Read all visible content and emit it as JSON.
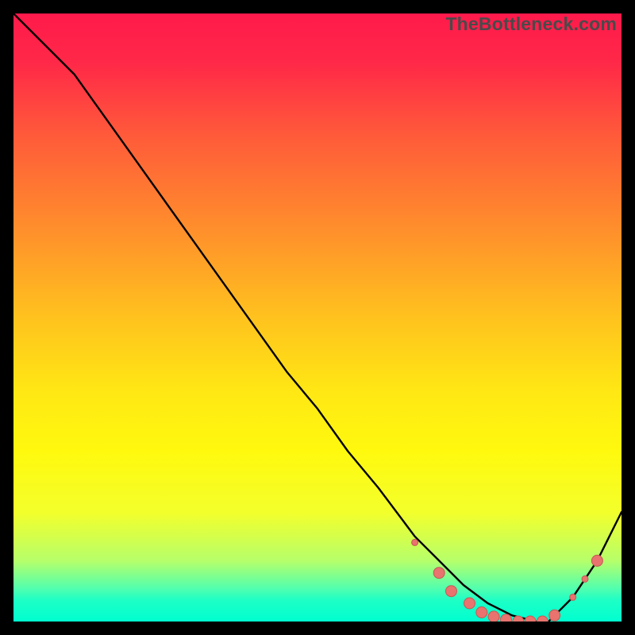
{
  "watermark": "TheBottleneck.com",
  "colors": {
    "gradient_stops": [
      {
        "offset": 0.0,
        "color": "#ff1a4b"
      },
      {
        "offset": 0.08,
        "color": "#ff2848"
      },
      {
        "offset": 0.2,
        "color": "#ff5a3a"
      },
      {
        "offset": 0.35,
        "color": "#ff8d2c"
      },
      {
        "offset": 0.5,
        "color": "#ffc21e"
      },
      {
        "offset": 0.62,
        "color": "#ffe714"
      },
      {
        "offset": 0.72,
        "color": "#fff90e"
      },
      {
        "offset": 0.82,
        "color": "#f3ff2b"
      },
      {
        "offset": 0.9,
        "color": "#b6ff6a"
      },
      {
        "offset": 0.945,
        "color": "#53ffad"
      },
      {
        "offset": 0.965,
        "color": "#1effc6"
      },
      {
        "offset": 1.0,
        "color": "#00ffd0"
      }
    ],
    "curve": "#000000",
    "markers_fill": "#e9736e",
    "markers_stroke": "#c25a55",
    "plot_border": "#000000"
  },
  "chart_data": {
    "type": "line",
    "title": "",
    "xlabel": "",
    "ylabel": "",
    "xlim": [
      0,
      100
    ],
    "ylim": [
      0,
      100
    ],
    "grid": false,
    "series": [
      {
        "name": "bottleneck-curve",
        "x": [
          0,
          6,
          10,
          15,
          20,
          25,
          30,
          35,
          40,
          45,
          50,
          55,
          60,
          63,
          66,
          70,
          74,
          78,
          82,
          86,
          88,
          92,
          96,
          100
        ],
        "y": [
          100,
          94,
          90,
          83,
          76,
          69,
          62,
          55,
          48,
          41,
          35,
          28,
          22,
          18,
          14,
          10,
          6,
          3,
          1,
          0,
          0,
          4,
          10,
          18
        ]
      }
    ],
    "markers": {
      "name": "highlight-points",
      "points": [
        {
          "x": 66,
          "y": 13,
          "r": 4
        },
        {
          "x": 70,
          "y": 8,
          "r": 7
        },
        {
          "x": 72,
          "y": 5,
          "r": 7
        },
        {
          "x": 75,
          "y": 3,
          "r": 7
        },
        {
          "x": 77,
          "y": 1.5,
          "r": 7
        },
        {
          "x": 79,
          "y": 0.8,
          "r": 7
        },
        {
          "x": 81,
          "y": 0.3,
          "r": 7
        },
        {
          "x": 83,
          "y": 0,
          "r": 7
        },
        {
          "x": 85,
          "y": 0,
          "r": 7
        },
        {
          "x": 87,
          "y": 0,
          "r": 7
        },
        {
          "x": 89,
          "y": 1,
          "r": 7
        },
        {
          "x": 92,
          "y": 4,
          "r": 4
        },
        {
          "x": 94,
          "y": 7,
          "r": 4
        },
        {
          "x": 96,
          "y": 10,
          "r": 7
        }
      ]
    }
  }
}
